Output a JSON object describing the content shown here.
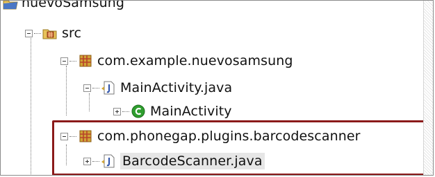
{
  "tree": {
    "project": {
      "label": "nuevoSamsung",
      "icon": "project-folder-icon"
    },
    "src": {
      "label": "src",
      "icon": "source-folder-icon"
    },
    "package1": {
      "label": "com.example.nuevosamsung",
      "icon": "package-icon"
    },
    "file1": {
      "label": "MainActivity.java",
      "icon": "java-file-icon"
    },
    "class1": {
      "label": "MainActivity",
      "icon": "class-icon"
    },
    "package2": {
      "label": "com.phonegap.plugins.barcodescanner",
      "icon": "package-icon"
    },
    "file2": {
      "label": "BarcodeScanner.java",
      "icon": "java-file-icon"
    }
  },
  "colors": {
    "highlight_border": "#8b1a1a",
    "package_icon": "#d0a437",
    "class_icon": "#2e9e2e",
    "selection": "#e6e6e6"
  }
}
